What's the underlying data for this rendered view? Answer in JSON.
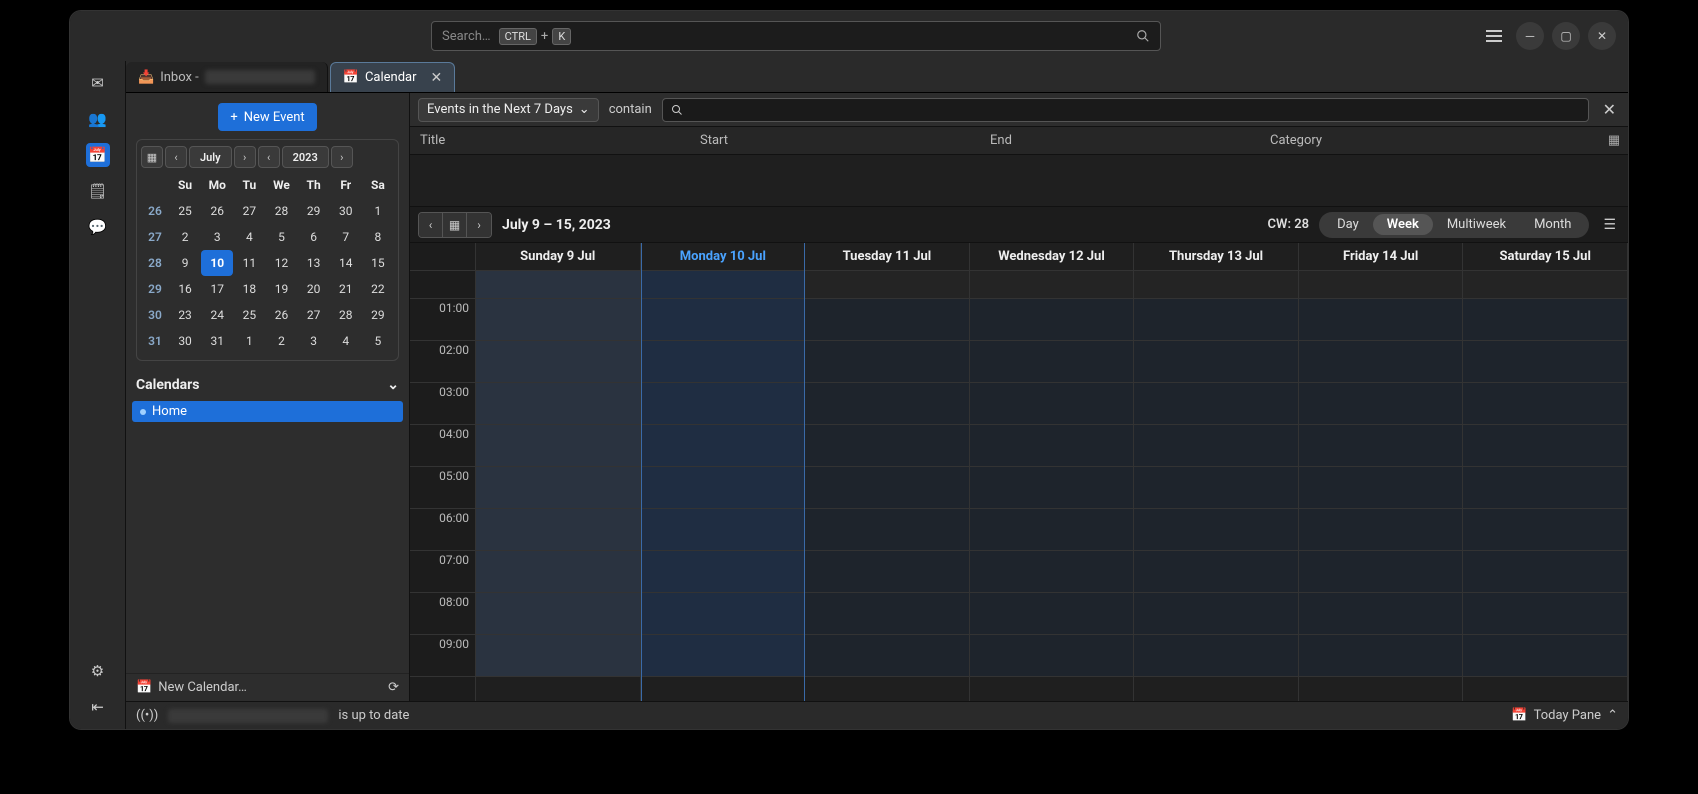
{
  "titlebar": {
    "search_placeholder": "Search…",
    "kbd1": "CTRL",
    "kbd_plus": "+",
    "kbd2": "K"
  },
  "leftrail": {
    "icons": [
      "mail-icon",
      "address-book-icon",
      "calendar-icon",
      "tasks-icon",
      "chat-icon"
    ],
    "active_index": 2
  },
  "tabs": [
    {
      "label": "Inbox - ",
      "icon": "inbox-icon",
      "active": false,
      "closable": false
    },
    {
      "label": "Calendar",
      "icon": "calendar-icon",
      "active": true,
      "closable": true
    }
  ],
  "sidebar": {
    "new_event": "New Event",
    "minical": {
      "month": "July",
      "year": "2023",
      "dow": [
        "Su",
        "Mo",
        "Tu",
        "We",
        "Th",
        "Fr",
        "Sa"
      ],
      "weeks": [
        {
          "wk": "26",
          "days": [
            {
              "d": "25",
              "dim": true
            },
            {
              "d": "26",
              "dim": true
            },
            {
              "d": "27",
              "dim": true
            },
            {
              "d": "28",
              "dim": true
            },
            {
              "d": "29",
              "dim": true
            },
            {
              "d": "30",
              "dim": true
            },
            {
              "d": "1"
            }
          ]
        },
        {
          "wk": "27",
          "days": [
            {
              "d": "2"
            },
            {
              "d": "3"
            },
            {
              "d": "4"
            },
            {
              "d": "5"
            },
            {
              "d": "6"
            },
            {
              "d": "7"
            },
            {
              "d": "8"
            }
          ]
        },
        {
          "wk": "28",
          "days": [
            {
              "d": "9"
            },
            {
              "d": "10",
              "today": true
            },
            {
              "d": "11"
            },
            {
              "d": "12"
            },
            {
              "d": "13"
            },
            {
              "d": "14"
            },
            {
              "d": "15"
            }
          ]
        },
        {
          "wk": "29",
          "days": [
            {
              "d": "16"
            },
            {
              "d": "17"
            },
            {
              "d": "18"
            },
            {
              "d": "19"
            },
            {
              "d": "20"
            },
            {
              "d": "21"
            },
            {
              "d": "22"
            }
          ]
        },
        {
          "wk": "30",
          "days": [
            {
              "d": "23"
            },
            {
              "d": "24"
            },
            {
              "d": "25"
            },
            {
              "d": "26"
            },
            {
              "d": "27"
            },
            {
              "d": "28"
            },
            {
              "d": "29"
            }
          ]
        },
        {
          "wk": "31",
          "days": [
            {
              "d": "30"
            },
            {
              "d": "31"
            },
            {
              "d": "1",
              "dim": true
            },
            {
              "d": "2",
              "dim": true
            },
            {
              "d": "3",
              "dim": true
            },
            {
              "d": "4",
              "dim": true
            },
            {
              "d": "5",
              "dim": true
            }
          ]
        }
      ]
    },
    "calendars_header": "Calendars",
    "calendars": [
      {
        "name": "Home"
      }
    ],
    "new_calendar": "New Calendar…"
  },
  "filterbar": {
    "range_dropdown": "Events in the Next 7 Days",
    "contain": "contain"
  },
  "list_header": {
    "title": "Title",
    "start": "Start",
    "end": "End",
    "category": "Category"
  },
  "viewbar": {
    "range": "July 9 – 15, 2023",
    "cw": "CW: 28",
    "tabs": [
      "Day",
      "Week",
      "Multiweek",
      "Month"
    ],
    "active_tab": "Week"
  },
  "week": {
    "days": [
      {
        "label": "Sunday 9 Jul",
        "cls": "sun"
      },
      {
        "label": "Monday 10 Jul",
        "cls": "today"
      },
      {
        "label": "Tuesday 11 Jul",
        "cls": ""
      },
      {
        "label": "Wednesday 12 Jul",
        "cls": ""
      },
      {
        "label": "Thursday 13 Jul",
        "cls": ""
      },
      {
        "label": "Friday 14 Jul",
        "cls": ""
      },
      {
        "label": "Saturday 15 Jul",
        "cls": ""
      }
    ],
    "hours": [
      "01:00",
      "02:00",
      "03:00",
      "04:00",
      "05:00",
      "06:00",
      "07:00",
      "08:00",
      "09:00"
    ]
  },
  "status": {
    "text": "is up to date",
    "today_pane": "Today Pane"
  }
}
